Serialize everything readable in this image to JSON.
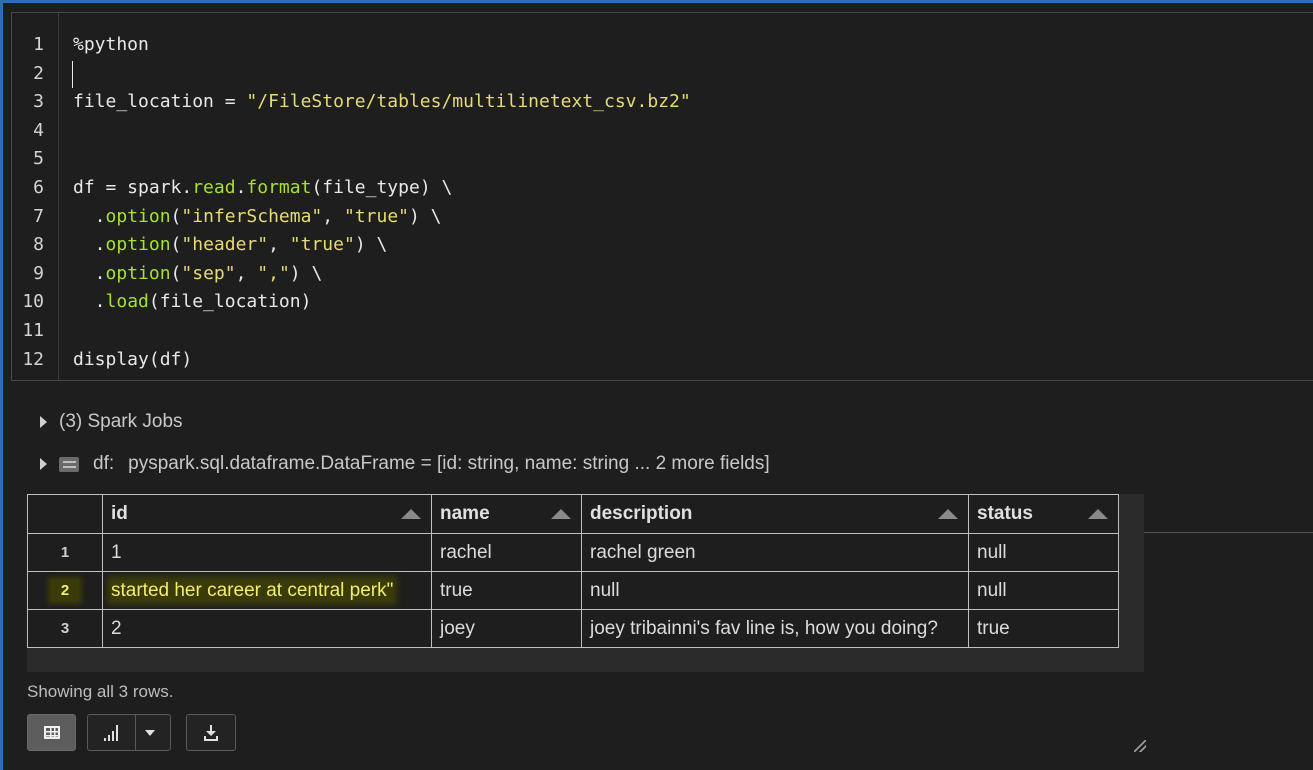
{
  "editor": {
    "lines": [
      {
        "n": "1",
        "parts": [
          {
            "t": "%python",
            "c": ""
          }
        ]
      },
      {
        "n": "2",
        "parts": [
          {
            "t": "",
            "c": ""
          }
        ]
      },
      {
        "n": "3",
        "parts": [
          {
            "t": "file_location = ",
            "c": ""
          },
          {
            "t": "\"/FileStore/tables/multilinetext_csv.bz2\"",
            "c": "tk-str"
          }
        ]
      },
      {
        "n": "4",
        "parts": [
          {
            "t": "",
            "c": ""
          }
        ]
      },
      {
        "n": "5",
        "parts": [
          {
            "t": "",
            "c": ""
          }
        ]
      },
      {
        "n": "6",
        "parts": [
          {
            "t": "df = spark.",
            "c": ""
          },
          {
            "t": "read",
            "c": "tk-fn"
          },
          {
            "t": ".",
            "c": ""
          },
          {
            "t": "format",
            "c": "tk-fn"
          },
          {
            "t": "(file_type) \\",
            "c": ""
          }
        ]
      },
      {
        "n": "7",
        "parts": [
          {
            "t": "  .",
            "c": ""
          },
          {
            "t": "option",
            "c": "tk-fn"
          },
          {
            "t": "(",
            "c": ""
          },
          {
            "t": "\"inferSchema\"",
            "c": "tk-str"
          },
          {
            "t": ", ",
            "c": ""
          },
          {
            "t": "\"true\"",
            "c": "tk-str"
          },
          {
            "t": ") \\",
            "c": ""
          }
        ]
      },
      {
        "n": "8",
        "parts": [
          {
            "t": "  .",
            "c": ""
          },
          {
            "t": "option",
            "c": "tk-fn"
          },
          {
            "t": "(",
            "c": ""
          },
          {
            "t": "\"header\"",
            "c": "tk-str"
          },
          {
            "t": ", ",
            "c": ""
          },
          {
            "t": "\"true\"",
            "c": "tk-str"
          },
          {
            "t": ") \\",
            "c": ""
          }
        ]
      },
      {
        "n": "9",
        "parts": [
          {
            "t": "  .",
            "c": ""
          },
          {
            "t": "option",
            "c": "tk-fn"
          },
          {
            "t": "(",
            "c": ""
          },
          {
            "t": "\"sep\"",
            "c": "tk-str"
          },
          {
            "t": ", ",
            "c": ""
          },
          {
            "t": "\",\"",
            "c": "tk-str"
          },
          {
            "t": ") \\",
            "c": ""
          }
        ]
      },
      {
        "n": "10",
        "parts": [
          {
            "t": "  .",
            "c": ""
          },
          {
            "t": "load",
            "c": "tk-fn"
          },
          {
            "t": "(file_location)",
            "c": ""
          }
        ]
      },
      {
        "n": "11",
        "parts": [
          {
            "t": "",
            "c": ""
          }
        ]
      },
      {
        "n": "12",
        "parts": [
          {
            "t": "display(df)",
            "c": ""
          }
        ]
      }
    ]
  },
  "output": {
    "spark_jobs": "(3) Spark Jobs",
    "df_label": "df:",
    "df_schema": "pyspark.sql.dataframe.DataFrame = [id: string, name: string ... 2 more fields]"
  },
  "table": {
    "columns": [
      "id",
      "name",
      "description",
      "status"
    ],
    "rows": [
      {
        "rn": "1",
        "cells": [
          "1",
          "rachel",
          "rachel green",
          "null"
        ]
      },
      {
        "rn": "2",
        "cells": [
          "started her career at central perk\"",
          "true",
          "null",
          "null"
        ]
      },
      {
        "rn": "3",
        "cells": [
          "2",
          "joey",
          "joey tribainni's fav line is, how you doing?",
          "true"
        ]
      }
    ],
    "highlighted_row": 1
  },
  "footer": {
    "showing": "Showing all 3 rows."
  },
  "toolbar": {
    "table_icon": "table-grid-icon",
    "chart_icon": "bar-chart-icon",
    "dropdown_icon": "caret-down-icon",
    "download_icon": "download-icon"
  },
  "colors": {
    "background": "#1e1e1e",
    "string": "#e6db74",
    "function": "#a6e22e",
    "highlight": "#f2ee6a"
  }
}
